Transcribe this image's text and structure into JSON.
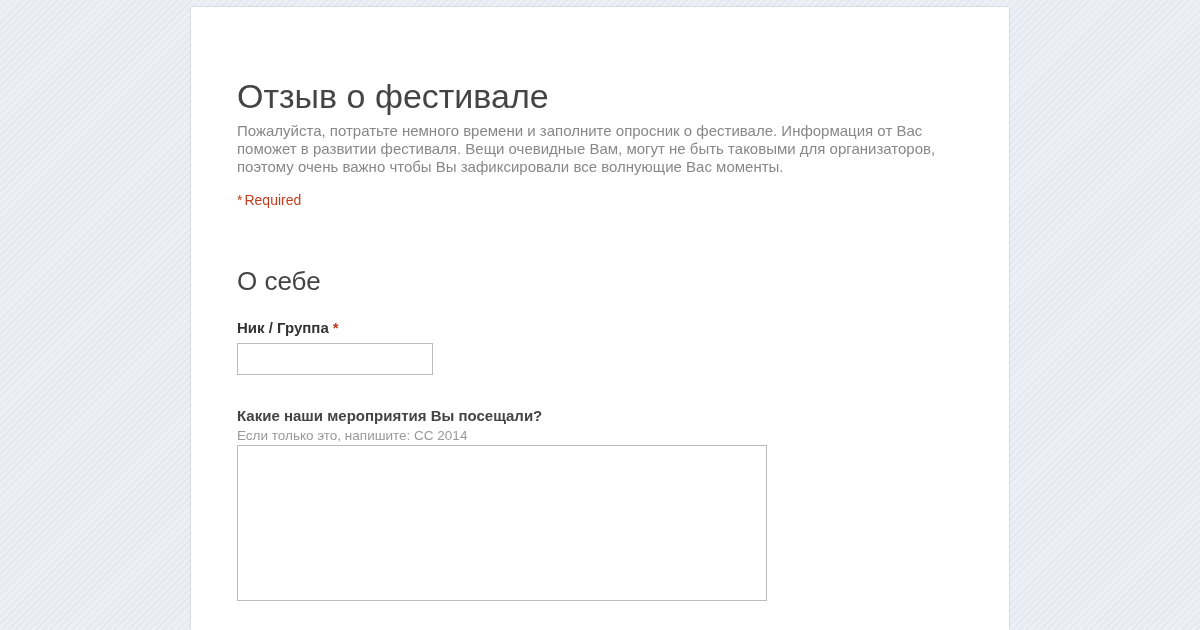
{
  "form": {
    "title": "Отзыв о фестивале",
    "description": "Пожалуйста, потратьте немного времени и заполните опросник о фестивале. Информация от Вас поможет в развитии фестиваля. Вещи очевидные Вам, могут не быть таковыми для организаторов, поэтому очень важно чтобы Вы зафиксировали все волнующие Вас моменты.",
    "required_mark": "*",
    "required_note": "Required"
  },
  "section": {
    "title": "О себе"
  },
  "questions": [
    {
      "kind": "text",
      "label": "Ник / Группа",
      "required": true,
      "required_mark": "*"
    },
    {
      "kind": "paragraph",
      "label": "Какие наши мероприятия Вы посещали?",
      "required": false,
      "help": "Если только это, напишите: СС 2014"
    }
  ]
}
